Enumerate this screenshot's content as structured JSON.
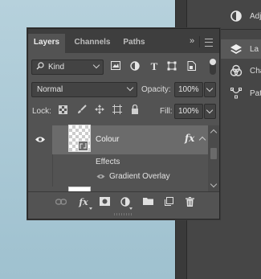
{
  "dock": {
    "items": [
      {
        "label": "Adj",
        "icon": "adjustments-icon"
      },
      {
        "label": "La",
        "icon": "layers-icon"
      },
      {
        "label": "Cha",
        "icon": "channels-icon"
      },
      {
        "label": "Pat",
        "icon": "paths-icon"
      }
    ]
  },
  "panel": {
    "tabs": [
      "Layers",
      "Channels",
      "Paths"
    ],
    "active_tab": "Layers",
    "menu_glyph": "»",
    "filter": {
      "kind_label": "Kind",
      "icons": [
        "image-filter-icon",
        "adjustment-filter-icon",
        "type-filter-icon",
        "shape-filter-icon",
        "smart-object-filter-icon"
      ]
    },
    "blend": {
      "mode": "Normal",
      "opacity_label": "Opacity:",
      "opacity_value": "100%"
    },
    "lock": {
      "label": "Lock:",
      "fill_label": "Fill:",
      "fill_value": "100%"
    },
    "layers": [
      {
        "name": "Colour",
        "fx": "fx",
        "effects_label": "Effects",
        "effects": [
          "Gradient Overlay"
        ]
      }
    ],
    "footer_icons": [
      "link-layers-icon",
      "add-style-icon",
      "add-mask-icon",
      "new-adjustment-icon",
      "new-group-icon",
      "new-layer-icon",
      "delete-layer-icon"
    ],
    "fx_footer": "fx"
  }
}
